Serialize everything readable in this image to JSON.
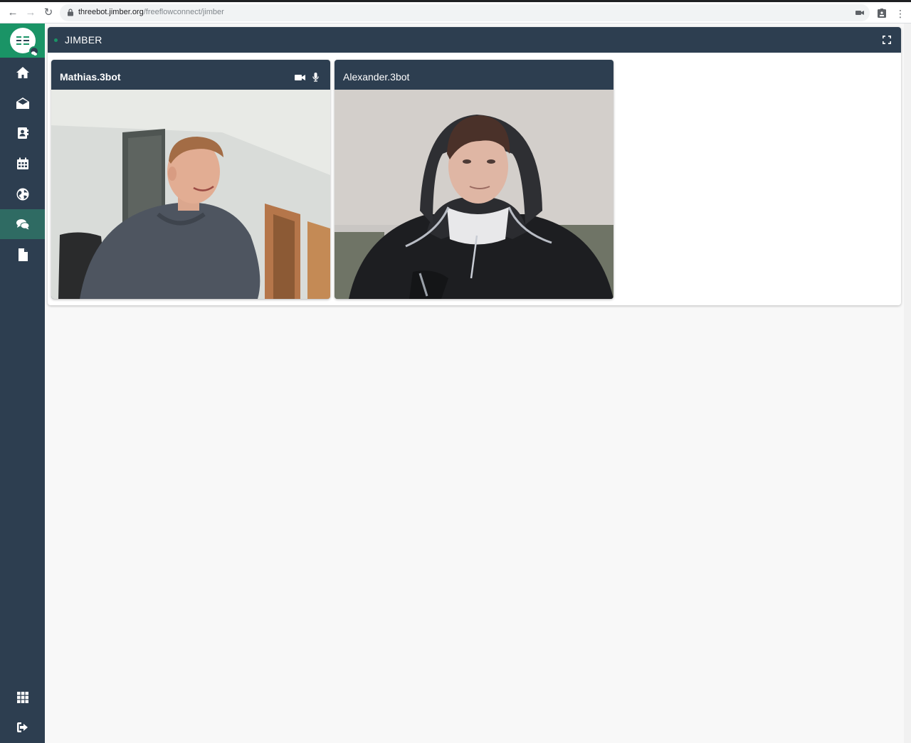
{
  "browser": {
    "url_host": "threebot.jimber.org",
    "url_path": "/freeflowconnect/jimber"
  },
  "sidebar": {
    "items": [
      {
        "name": "home-icon"
      },
      {
        "name": "mail-icon"
      },
      {
        "name": "contacts-icon"
      },
      {
        "name": "calendar-icon"
      },
      {
        "name": "globe-icon"
      },
      {
        "name": "chat-icon",
        "active": true
      },
      {
        "name": "file-icon"
      }
    ],
    "bottom_items": [
      {
        "name": "apps-grid-icon"
      },
      {
        "name": "logout-icon"
      }
    ]
  },
  "room": {
    "title": "JIMBER"
  },
  "participants": [
    {
      "name": "Mathias.3bot",
      "is_self": true
    },
    {
      "name": "Alexander.3bot",
      "is_self": false
    }
  ],
  "colors": {
    "sidebar": "#2d3e50",
    "accent": "#1a9466",
    "header": "#2d3e50"
  }
}
